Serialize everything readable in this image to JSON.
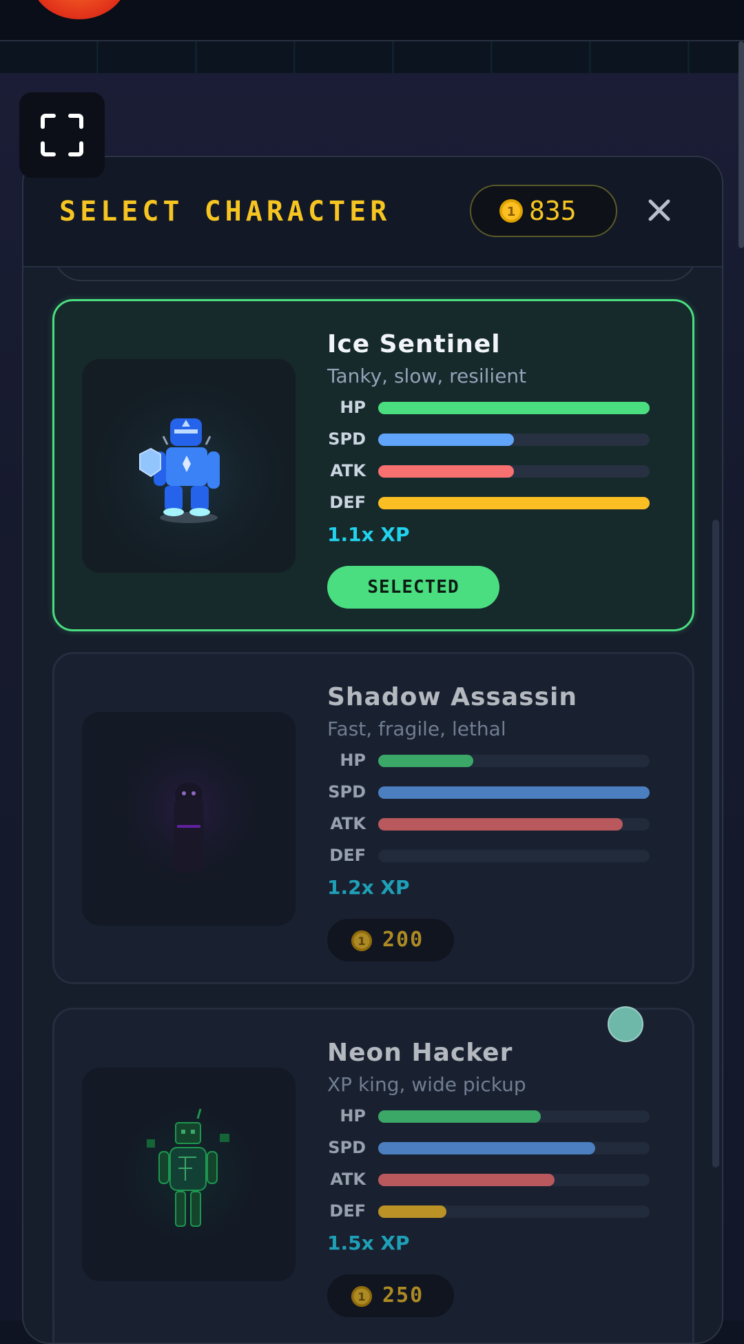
{
  "header": {
    "title": "SELECT CHARACTER",
    "coin_balance": "835",
    "close_icon": "close-icon",
    "fullscreen_icon": "fullscreen-icon"
  },
  "characters": [
    {
      "name": "Ice Sentinel",
      "description": "Tanky, slow, resilient",
      "stats": [
        {
          "label": "HP",
          "value": 1.0,
          "color": "#4ade80"
        },
        {
          "label": "SPD",
          "value": 0.5,
          "color": "#60a5fa"
        },
        {
          "label": "ATK",
          "value": 0.5,
          "color": "#f87171"
        },
        {
          "label": "DEF",
          "value": 1.0,
          "color": "#fbbf24"
        }
      ],
      "xp": "1.1x XP",
      "action": "SELECTED",
      "selected": true
    },
    {
      "name": "Shadow Assassin",
      "description": "Fast, fragile, lethal",
      "stats": [
        {
          "label": "HP",
          "value": 0.35,
          "color": "#4ade80"
        },
        {
          "label": "SPD",
          "value": 1.0,
          "color": "#60a5fa"
        },
        {
          "label": "ATK",
          "value": 0.9,
          "color": "#f87171"
        },
        {
          "label": "DEF",
          "value": 0.0,
          "color": "#fbbf24"
        }
      ],
      "xp": "1.2x XP",
      "price": "200",
      "selected": false
    },
    {
      "name": "Neon Hacker",
      "description": "XP king, wide pickup",
      "stats": [
        {
          "label": "HP",
          "value": 0.6,
          "color": "#4ade80"
        },
        {
          "label": "SPD",
          "value": 0.8,
          "color": "#60a5fa"
        },
        {
          "label": "ATK",
          "value": 0.65,
          "color": "#f87171"
        },
        {
          "label": "DEF",
          "value": 0.25,
          "color": "#fbbf24"
        }
      ],
      "xp": "1.5x XP",
      "price": "250",
      "selected": false
    }
  ]
}
